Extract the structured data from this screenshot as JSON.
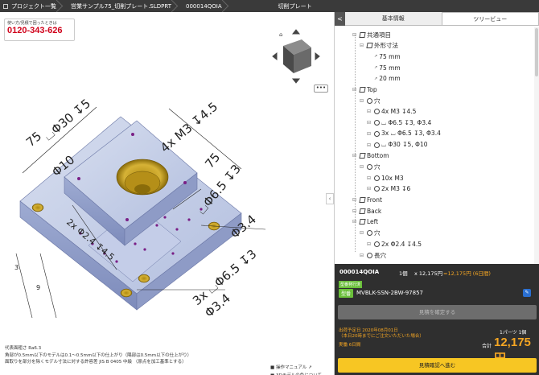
{
  "breadcrumb": {
    "home": "プロジェクト一覧",
    "file": "営業サンプル75_切削プレート.SLDPRT",
    "code": "000014QOIA",
    "title": "切削プレート"
  },
  "help": {
    "text": "使い方/見積で困ったときは",
    "phone": "0120-343-626"
  },
  "menu_button": "•••",
  "viewer_annotations": {
    "d1": "75",
    "d2": "⌴Φ30 ↧5",
    "d3": "Φ10",
    "d4": "4x M3 ↧4.5",
    "d5": "75",
    "d6": "⌴Φ6.5 ↧3",
    "d7": "Φ3.4",
    "d8": "2x Φ2.4 ↧4.5",
    "d9": "3x ⌴Φ6.5 ↧3",
    "d10": "Φ3.4",
    "d11": "3",
    "d12": "9"
  },
  "notes": [
    "代表面粗さ Ra6.3",
    "角部が0.5mm以下のモデルは0.1〜0.5mm以下の仕上がり（隅部は0.5mm以下の仕上がり）",
    "面取りを部分を除くモデル寸法に対する許容差 JIS B 0405 中級 （原点を加工基準とする）"
  ],
  "links": {
    "manual": "操作マニュアル",
    "color": "3Dモデルの色について"
  },
  "tabs": {
    "back": "<",
    "basic": "基本情報",
    "tree": "ツリービュー"
  },
  "tree": [
    {
      "indent": 0,
      "icon": "cube",
      "label": "共通項目"
    },
    {
      "indent": 1,
      "icon": "cube",
      "label": "外形寸法"
    },
    {
      "indent": 2,
      "icon": "axis",
      "label": "75 mm"
    },
    {
      "indent": 2,
      "icon": "axis",
      "label": "75 mm"
    },
    {
      "indent": 2,
      "icon": "axis",
      "label": "20 mm"
    },
    {
      "indent": 0,
      "icon": "cube",
      "label": "Top"
    },
    {
      "indent": 1,
      "icon": "circ",
      "label": "穴"
    },
    {
      "indent": 2,
      "icon": "circ",
      "label": "4x M3 ↧4.5"
    },
    {
      "indent": 2,
      "icon": "circ",
      "label": "⌴ Φ6.5 ↧3, Φ3.4"
    },
    {
      "indent": 2,
      "icon": "circ",
      "label": "3x ⌴ Φ6.5 ↧3, Φ3.4"
    },
    {
      "indent": 2,
      "icon": "circ",
      "label": "⌴ Φ30 ↧5, Φ10"
    },
    {
      "indent": 0,
      "icon": "cube",
      "label": "Bottom"
    },
    {
      "indent": 1,
      "icon": "circ",
      "label": "穴"
    },
    {
      "indent": 2,
      "icon": "circ",
      "label": "10x M3"
    },
    {
      "indent": 2,
      "icon": "circ",
      "label": "2x M3 ↧6"
    },
    {
      "indent": 0,
      "icon": "cube",
      "label": "Front"
    },
    {
      "indent": 0,
      "icon": "cube",
      "label": "Back"
    },
    {
      "indent": 0,
      "icon": "cube",
      "label": "Left"
    },
    {
      "indent": 1,
      "icon": "circ",
      "label": "穴"
    },
    {
      "indent": 2,
      "icon": "circ",
      "label": "2x Φ2.4 ↧4.5"
    },
    {
      "indent": 1,
      "icon": "circ",
      "label": "長穴"
    }
  ],
  "order": {
    "code": "000014QOIA",
    "qty": "1個",
    "unit_price": "x 12,175円",
    "total_line": "=12,175円 (6日間)",
    "badge": "型番発行済",
    "tag": "型番",
    "part_no": "MVBLK-SSN-2BW-97857",
    "confirm": "見積を確定する",
    "ship1": "出荷予定日 2020年08月01日",
    "ship2": "（本日20時までにご注文いただいた場合）",
    "days": "実働 6日間",
    "per_part": "1パーツ 1個",
    "sum_label": "合計",
    "sum": "12,175円",
    "quote": "見積確認へ進む"
  },
  "colors": {
    "part": "#b7c3e4",
    "hole": "#c8a21e",
    "accent": "#f5a623",
    "confirm": "#f7c623"
  }
}
